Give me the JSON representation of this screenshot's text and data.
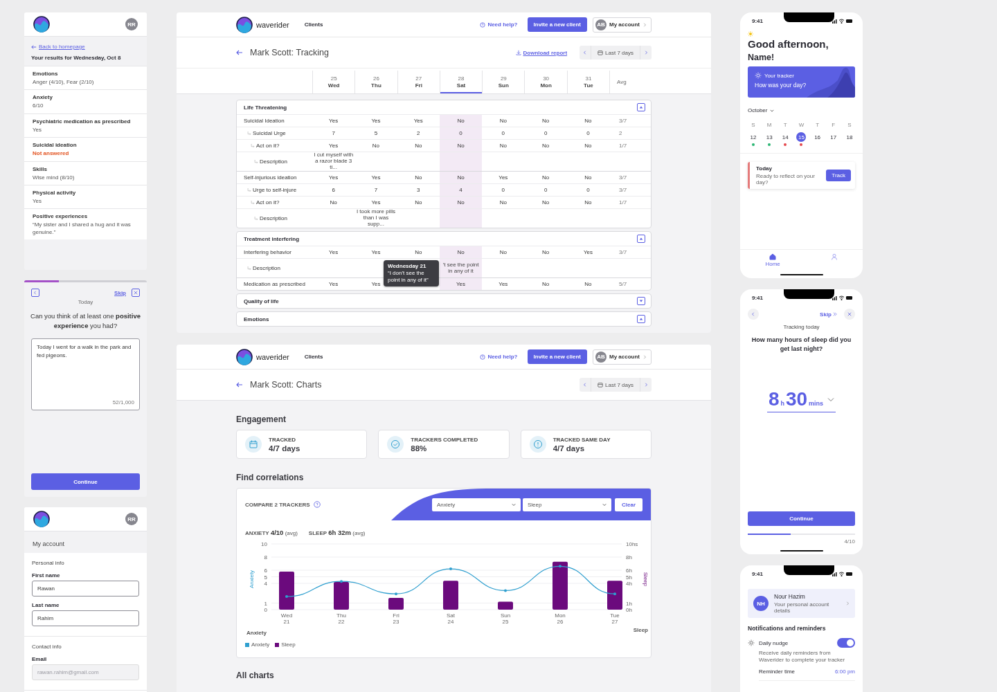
{
  "results_card": {
    "avatar": "RR",
    "back_link": "Back to homepage",
    "heading": "Your results for Wednesday, Oct 8",
    "items": [
      {
        "label": "Emotions",
        "value": "Anger (4/10), Fear (2/10)",
        "answered": true
      },
      {
        "label": "Anxiety",
        "value": "6/10",
        "answered": true
      },
      {
        "label": "Psychiatric medication as prescribed",
        "value": "Yes",
        "answered": true
      },
      {
        "label": "Suicidal ideation",
        "value": "Not answered",
        "answered": false
      },
      {
        "label": "Skills",
        "value": "Wise mind (8/10)",
        "answered": true
      },
      {
        "label": "Physical activity",
        "value": "Yes",
        "answered": true
      },
      {
        "label": "Positive experiences",
        "value": "“My sister and I shared a hug and it was genuine.”",
        "answered": true
      }
    ]
  },
  "prompt_card": {
    "level": 0.28,
    "skip": "Skip",
    "date": "Today",
    "question": "Can you think of at least one **positive experience** you had?",
    "answer": "Today I went for a walk in the park and fed pigeons.",
    "counter": "52/1,000",
    "button": "Continue"
  },
  "account_card": {
    "avatar": "RR",
    "title": "My account",
    "sections": [
      {
        "title": "Personal info",
        "fields": [
          {
            "label": "First name",
            "value": "Rawan",
            "disabled": false
          },
          {
            "label": "Last name",
            "value": "Rahim",
            "disabled": false
          }
        ]
      },
      {
        "title": "Contact info",
        "fields": [
          {
            "label": "Email",
            "placeholder": "rawan.rahim@gmail.com",
            "disabled": true
          }
        ]
      }
    ]
  },
  "tracking": {
    "nav": {
      "brand": "waverider",
      "link": "Clients",
      "help": "Need help?",
      "invite": "Invite a new client",
      "avatar": "AB",
      "account": "My account"
    },
    "title": "Mark Scott: Tracking",
    "download": "Download report",
    "range": "Last 7 days",
    "days": [
      {
        "num": "25",
        "name": "Wed",
        "selected": false
      },
      {
        "num": "26",
        "name": "Thu",
        "selected": false
      },
      {
        "num": "27",
        "name": "Fri",
        "selected": false
      },
      {
        "num": "28",
        "name": "Sat",
        "selected": true
      },
      {
        "num": "29",
        "name": "Sun",
        "selected": false
      },
      {
        "num": "30",
        "name": "Mon",
        "selected": false
      },
      {
        "num": "31",
        "name": "Tue",
        "selected": false
      }
    ],
    "avg": "Avg",
    "sections": [
      {
        "title": "Life Threatening",
        "expanded": true,
        "rows": [
          {
            "kind": "value",
            "label": "Suicidal Ideation",
            "values": [
              "Yes",
              "Yes",
              "Yes",
              "No",
              "No",
              "No",
              "No"
            ],
            "avg": "3/7",
            "children": [
              {
                "kind": "value",
                "label": "Suicidal Urge",
                "values": [
                  "7",
                  "5",
                  "2",
                  "0",
                  "0",
                  "0",
                  "0"
                ],
                "avg": "2",
                "children": [
                  {
                    "kind": "value",
                    "label": "Act on it?",
                    "values": [
                      "Yes",
                      "No",
                      "No",
                      "No",
                      "No",
                      "No",
                      "No"
                    ],
                    "avg": "1/7",
                    "children": [
                      {
                        "kind": "note",
                        "label": "Description",
                        "cells": [
                          {
                            "kind": "text",
                            "text": "I cut myself with a razor blade 3 ti..."
                          },
                          {
                            "kind": "blank"
                          },
                          {
                            "kind": "blank"
                          },
                          {
                            "kind": "blank"
                          },
                          {
                            "kind": "blank"
                          },
                          {
                            "kind": "blank"
                          },
                          {
                            "kind": "blank"
                          }
                        ]
                      }
                    ]
                  }
                ]
              }
            ]
          },
          {
            "kind": "value",
            "label": "Self-injurious ideation",
            "values": [
              "Yes",
              "Yes",
              "No",
              "No",
              "Yes",
              "No",
              "No"
            ],
            "avg": "3/7",
            "children": [
              {
                "kind": "value",
                "label": "Urge to self-injure",
                "values": [
                  "6",
                  "7",
                  "3",
                  "4",
                  "0",
                  "0",
                  "0"
                ],
                "avg": "3/7",
                "children": [
                  {
                    "kind": "value",
                    "label": "Act on it?",
                    "values": [
                      "No",
                      "Yes",
                      "No",
                      "No",
                      "No",
                      "No",
                      "No"
                    ],
                    "avg": "1/7",
                    "children": [
                      {
                        "kind": "note",
                        "label": "Description",
                        "cells": [
                          {
                            "kind": "blank"
                          },
                          {
                            "kind": "text",
                            "text": "I took more pills than I was supp..."
                          },
                          {
                            "kind": "blank"
                          },
                          {
                            "kind": "blank"
                          },
                          {
                            "kind": "blank"
                          },
                          {
                            "kind": "blank"
                          },
                          {
                            "kind": "blank"
                          }
                        ]
                      }
                    ]
                  }
                ]
              }
            ]
          }
        ]
      },
      {
        "title": "Treatment interfering",
        "expanded": true,
        "rows": [
          {
            "kind": "value",
            "label": "Interfering behavior",
            "values": [
              "Yes",
              "Yes",
              "No",
              "No",
              "No",
              "No",
              "Yes"
            ],
            "avg": "3/7",
            "children": [
              {
                "kind": "note",
                "label": "Description",
                "cells": [
                  {
                    "kind": "blank"
                  },
                  {
                    "kind": "blank"
                  },
                  {
                    "kind": "blank"
                  },
                  {
                    "kind": "text",
                    "text": "’t see the point in any of it"
                  },
                  {
                    "kind": "blank"
                  },
                  {
                    "kind": "blank"
                  },
                  {
                    "kind": "blank"
                  }
                ],
                "tooltip": {
                  "title": "Wednesday 21",
                  "text": "“I don't see the point in any of it”"
                }
              }
            ]
          },
          {
            "kind": "value",
            "label": "Medication as prescribed",
            "cells": [
              {
                "kind": "text",
                "text": "Yes"
              },
              {
                "kind": "text",
                "text": "Yes"
              },
              {
                "kind": "blank"
              },
              {
                "kind": "text",
                "text": "Yes"
              },
              {
                "kind": "text",
                "text": "Yes"
              },
              {
                "kind": "text",
                "text": "No"
              },
              {
                "kind": "text",
                "text": "No"
              }
            ],
            "avg": "5/7"
          }
        ]
      },
      {
        "title": "Quality of life",
        "expanded": false
      },
      {
        "title": "Emotions",
        "expanded": true
      }
    ]
  },
  "charts": {
    "nav": {
      "brand": "waverider",
      "link": "Clients",
      "help": "Need help?",
      "invite": "Invite a new client",
      "avatar": "AB",
      "account": "My account"
    },
    "title": "Mark Scott: Charts",
    "range": "Last 7 days",
    "engagement_title": "Engagement",
    "stats": [
      {
        "kind": "calendar",
        "label": "TRACKED",
        "value": "4/7 days"
      },
      {
        "kind": "check",
        "label": "TRACKERS COMPLETED",
        "value": "88%"
      },
      {
        "kind": "alert",
        "label": "TRACKED SAME DAY",
        "value": "4/7 days"
      }
    ],
    "correlations_title": "Find correlations",
    "compare_label": "COMPARE 2 TRACKERS",
    "selects": [
      "Anxiety",
      "Sleep"
    ],
    "clear": "Clear",
    "summary": [
      {
        "name": "ANXIETY",
        "value": "4/10",
        "unit": "(avg)"
      },
      {
        "name": "SLEEP",
        "value": "6h 32m",
        "unit": "(avg)"
      }
    ],
    "axis_captions": [
      "Anxiety",
      "Sleep"
    ],
    "chart_data": {
      "type": "bar",
      "grid": true,
      "ylabel": "Anxiety",
      "y2label": "Sleep",
      "categories": [
        "Wed 21",
        "Thu 22",
        "Fri 23",
        "Sat 24",
        "Sun 25",
        "Mon 26",
        "Tue 27"
      ],
      "ylim": [
        0,
        10
      ],
      "y2lim": [
        0,
        10
      ],
      "yticks": [
        0,
        1,
        4,
        5,
        6,
        8,
        10
      ],
      "y2ticks": [
        {
          "value": 0,
          "label": "0h"
        },
        {
          "value": 1,
          "label": "1h"
        },
        {
          "value": 4,
          "label": "4h"
        },
        {
          "value": 5,
          "label": "5h"
        },
        {
          "value": 6,
          "label": "6h"
        },
        {
          "value": 8,
          "label": "8h"
        },
        {
          "value": 10,
          "label": "10hs"
        }
      ],
      "series": [
        {
          "name": "Anxiety",
          "type": "line",
          "color": "#2f9fcf",
          "values": [
            2,
            4.3,
            2.4,
            6.2,
            2.9,
            6.6,
            2.4
          ]
        },
        {
          "name": "Sleep",
          "type": "bar",
          "color": "#6b0a7d",
          "values": [
            5.8,
            4.2,
            1.8,
            4.4,
            1.2,
            7.3,
            4.4
          ]
        }
      ]
    },
    "all_charts_title": "All charts"
  },
  "home_phone": {
    "time": "9:41",
    "greeting": "Good afternoon,",
    "name": "Name!",
    "tracker_label": "Your tracker",
    "tracker_prompt": "How was your day?",
    "month": "October",
    "weekdays": [
      "S",
      "M",
      "T",
      "W",
      "T",
      "F",
      "S"
    ],
    "dates": [
      {
        "day": "12",
        "color": "#2bb673",
        "selected": false
      },
      {
        "day": "13",
        "color": "#2bb673",
        "selected": false
      },
      {
        "day": "14",
        "color": "#e5484d",
        "selected": false
      },
      {
        "day": "15",
        "color": "#e5484d",
        "selected": true
      },
      {
        "day": "16",
        "selected": false
      },
      {
        "day": "17",
        "selected": false
      },
      {
        "day": "18",
        "selected": false
      }
    ],
    "today_title": "Today",
    "today_text": "Ready to reflect on your day?",
    "today_button": "Track",
    "tabs": [
      {
        "kind": "home",
        "label": "Home",
        "selected": true
      },
      {
        "kind": "person",
        "selected": false
      }
    ]
  },
  "sleep_phone": {
    "time": "9:41",
    "skip": "Skip",
    "title": "Tracking today",
    "question": "How many hours of sleep did you get last night?",
    "hours": "8",
    "hours_unit": "h",
    "minutes": "30",
    "minutes_unit": "mins",
    "button": "Continue",
    "level": 0.4,
    "counter": "4/10"
  },
  "settings_phone": {
    "time": "9:41",
    "initials": "NH",
    "name": "Nour Hazim",
    "subtitle": "Your personal account details",
    "heading": "Notifications and reminders",
    "settings": [
      {
        "label": "Daily nudge",
        "on": true,
        "description": "Receive daily reminders from Waverider to complete your tracker"
      }
    ],
    "reminder_label": "Reminder time",
    "reminder_value": "6:00 pm"
  }
}
